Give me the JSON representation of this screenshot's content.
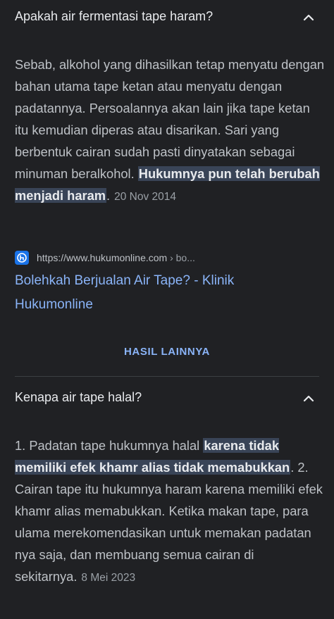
{
  "faq": [
    {
      "question": "Apakah air fermentasi tape haram?",
      "expanded_icon": "chevron-up-icon",
      "answer_plain": "Sebab, alkohol yang dihasilkan tetap menyatu dengan bahan utama tape ketan atau menyatu dengan padatannya. Persoalannya akan lain jika tape ketan itu kemudian diperas atau disarikan. Sari yang berbentuk cairan sudah pasti dinyatakan sebagai minuman beralkohol.",
      "answer_highlight": "Hukumnya pun telah berubah menjadi haram",
      "answer_suffix": ".",
      "date": "20 Nov 2014",
      "source": {
        "url": "https://www.hukumonline.com",
        "url_path": " › bo...",
        "title": "Bolehkah Berjualan Air Tape? - Klinik Hukumonline",
        "favicon": "hukumonline-logo"
      }
    },
    {
      "question": "Kenapa air tape halal?",
      "expanded_icon": "chevron-up-icon",
      "answer_prefix": "1. Padatan tape hukumnya halal ",
      "answer_highlight": "karena tidak memiliki efek khamr alias tidak memabukkan",
      "answer_rest": ". 2. Cairan tape itu hukumnya haram karena memiliki efek khamr alias memabukkan. Ketika makan tape, para ulama merekomendasikan untuk memakan padatan nya saja, dan membuang semua cairan di sekitarnya.",
      "date": "8 Mei 2023"
    }
  ],
  "more_results_label": "HASIL LAINNYA",
  "colors": {
    "background": "#202124",
    "text": "#bdc1c6",
    "link": "#8ab4f8",
    "highlight": "#394457"
  }
}
